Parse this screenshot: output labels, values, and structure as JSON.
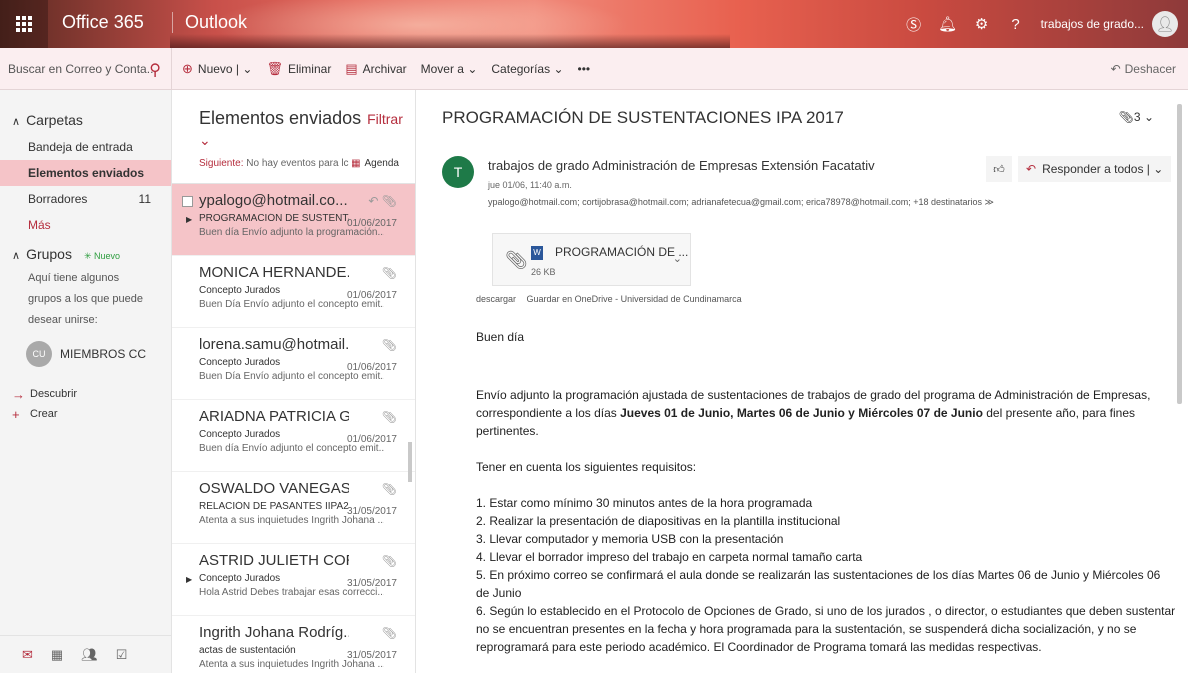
{
  "topbar": {
    "brand": "Office 365",
    "app": "Outlook",
    "user": "trabajos de grado...",
    "icons": [
      "skype-icon",
      "bell-icon",
      "gear-icon",
      "help-icon"
    ]
  },
  "search": {
    "placeholder": "Buscar en Correo y Conta..."
  },
  "commands": {
    "nuevo": "Nuevo",
    "eliminar": "Eliminar",
    "archivar": "Archivar",
    "mover": "Mover a",
    "categorias": "Categorías",
    "more": "•••",
    "deshacer": "Deshacer"
  },
  "nav": {
    "carpetas": "Carpetas",
    "items": [
      {
        "label": "Bandeja de entrada",
        "count": ""
      },
      {
        "label": "Elementos enviados",
        "count": ""
      },
      {
        "label": "Borradores",
        "count": "11"
      },
      {
        "label": "Más",
        "count": ""
      }
    ],
    "grupos": "Grupos",
    "nuevo_badge": "✳ Nuevo",
    "grupos_desc": "Aquí tiene algunos grupos a los que puede desear unirse:",
    "group_avatar": "CU",
    "group_name": "MIEMBROS CC",
    "descubrir": "Descubrir",
    "crear": "Crear"
  },
  "list": {
    "header": "Elementos enviados",
    "filter": "Filtrar",
    "next_label": "Siguiente:",
    "next_text": "No hay eventos para lc",
    "agenda": "Agenda",
    "messages": [
      {
        "from": "ypalogo@hotmail.co...",
        "subject": "PROGRAMACIÓN DE SUSTENTAC",
        "date": "01/06/2017",
        "preview": "Buen día  Envío adjunto la programación..."
      },
      {
        "from": "MONICA HERNANDE...",
        "subject": "Concepto Jurados",
        "date": "01/06/2017",
        "preview": "Buen Día  Envío adjunto el concepto emit..."
      },
      {
        "from": "lorena.samu@hotmail...",
        "subject": "Concepto Jurados",
        "date": "01/06/2017",
        "preview": "Buen Día  Envío adjunto el concepto emit..."
      },
      {
        "from": "ARIADNA PATRICIA G...",
        "subject": "Concepto Jurados",
        "date": "01/06/2017",
        "preview": "Buen día  Envío adjunto el concepto emit..."
      },
      {
        "from": "OSWALDO VANEGAS...",
        "subject": "RELACIÓN DE PASANTES IIPA201(",
        "date": "31/05/2017",
        "preview": "Atenta a sus inquietudes  Ingrith Johana ..."
      },
      {
        "from": "ASTRID JULIETH COR...",
        "subject": "Concepto Jurados",
        "date": "31/05/2017",
        "preview": "Hola Astrid  Debes trabajar esas correcci..."
      },
      {
        "from": "Ingrith Johana Rodríg...",
        "subject": "actas de sustentación",
        "date": "31/05/2017",
        "preview": "Atenta a sus inquietudes  Ingrith Johana ..."
      }
    ]
  },
  "reading": {
    "title": "PROGRAMACIÓN DE SUSTENTACIONES IPA 2017",
    "att_count": "3",
    "sender_initial": "T",
    "sender": "trabajos de grado Administración de Empresas Extensión Facatativ",
    "date": "jue 01/06, 11:40 a.m.",
    "recipients": "ypalogo@hotmail.com; cortijobrasa@hotmail.com; adrianafetecua@gmail.com; erica78978@hotmail.com; +18 destinatarios ≫",
    "reply_all": "Responder a todos",
    "attachment_name": "PROGRAMACIÓN DE ...",
    "attachment_size": "26 KB",
    "link_download": "descargar",
    "link_onedrive": "Guardar en OneDrive - Universidad de Cundinamarca",
    "greeting": "Buen día",
    "p1_a": "Envío adjunto la programación ajustada de sustentaciones de trabajos de grado del programa de Administración de Empresas, correspondiente a los días ",
    "p1_b": "Jueves 01 de Junio, Martes 06 de Junio y Miércoles 07 de Junio",
    "p1_c": " del presente año, para fines pertinentes.",
    "p2": "Tener en cuenta los siguientes requisitos:",
    "reqs": [
      "1. Estar como mínimo 30 minutos antes de la hora programada",
      "2. Realizar la presentación de diapositivas en la plantilla institucional",
      "3. Llevar computador y memoria USB con la presentación",
      "4. Llevar el borrador impreso del trabajo en carpeta normal tamaño carta",
      "5. En próximo correo se confirmará el aula donde se realizarán las sustentaciones de los días Martes 06 de Junio y Miércoles 06 de Junio",
      "6. Según lo establecido en el Protocolo de Opciones de Grado, si uno de los jurados , o director, o estudiantes que deben sustentar no se encuentran presentes en la fecha y hora programada para la sustentación, se suspenderá dicha socialización, y no se reprogramará para este periodo académico. El Coordinador de Programa tomará las medidas respectivas."
    ]
  },
  "colors": {
    "accent": "#b52d3d",
    "selected": "#f5c4c8",
    "command_bar": "#fbeef0",
    "avatar": "#1e7a48"
  }
}
